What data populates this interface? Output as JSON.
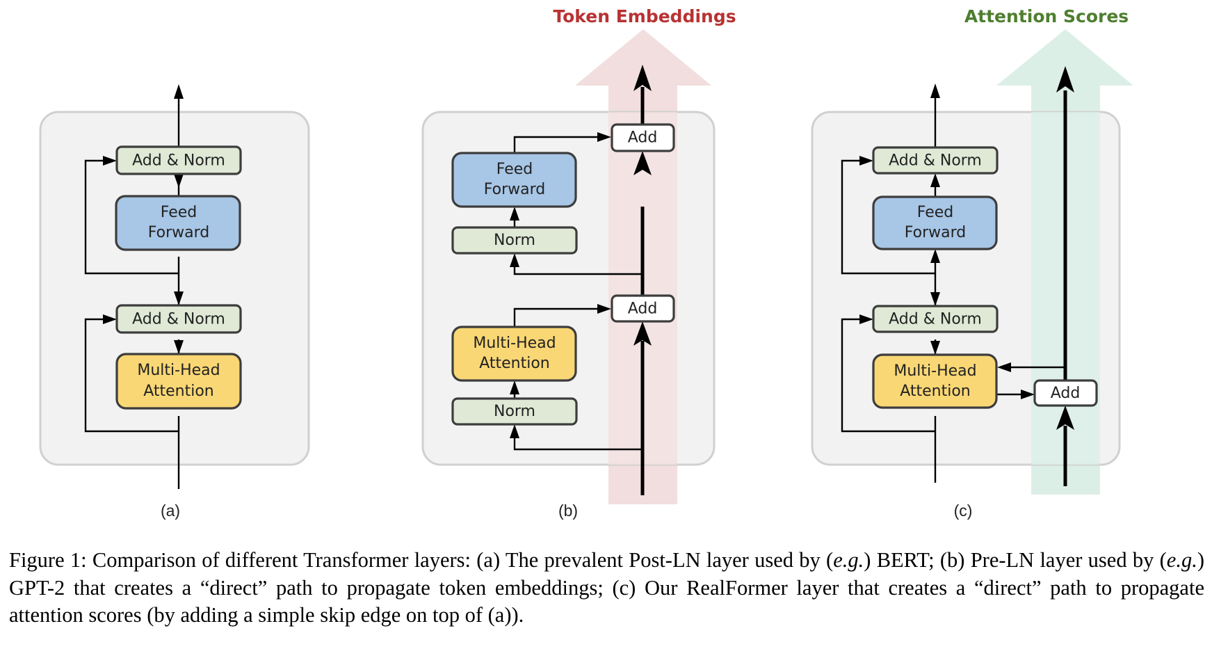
{
  "figure": {
    "highlights": {
      "token_embeddings": {
        "title": "Token Embeddings",
        "color": "#b83232",
        "band_color": "#f2dede"
      },
      "attention_scores": {
        "title": "Attention Scores",
        "color": "#4e7f2f",
        "band_color": "#dcefe7"
      }
    },
    "colors": {
      "attention_fill": "#f9d775",
      "feedforward_fill": "#a8c6e6",
      "norm_fill": "#dfe9d6",
      "add_fill": "#ffffff",
      "panel_fill": "#f2f2f2"
    },
    "panels": [
      {
        "label": "(a)",
        "description": "Post-LN layer",
        "nodes": {
          "add_norm_top": "Add & Norm",
          "feed_forward": [
            "Feed",
            "Forward"
          ],
          "add_norm_bottom": "Add & Norm",
          "multi_head_attention": [
            "Multi-Head",
            "Attention"
          ]
        }
      },
      {
        "label": "(b)",
        "description": "Pre-LN layer",
        "nodes": {
          "add_top": "Add",
          "feed_forward": [
            "Feed",
            "Forward"
          ],
          "norm_top": "Norm",
          "add_bottom": "Add",
          "multi_head_attention": [
            "Multi-Head",
            "Attention"
          ],
          "norm_bottom": "Norm"
        }
      },
      {
        "label": "(c)",
        "description": "RealFormer layer",
        "nodes": {
          "add_norm_top": "Add & Norm",
          "feed_forward": [
            "Feed",
            "Forward"
          ],
          "add_norm_bottom": "Add & Norm",
          "multi_head_attention": [
            "Multi-Head",
            "Attention"
          ],
          "add_scores": "Add"
        }
      }
    ]
  },
  "caption": {
    "prefix": "Figure 1: Comparison of different Transformer layers: (a) The prevalent Post-LN layer used by ",
    "eg1": "e.g.",
    "part2": " BERT; (b) Pre-LN layer used by ",
    "eg2": "e.g.",
    "part3": " GPT-2 that creates a “direct” path to propagate token embeddings; (c) Our RealFormer layer that creates a “direct” path to propagate attention scores (by adding a simple skip edge on top of (a))."
  }
}
